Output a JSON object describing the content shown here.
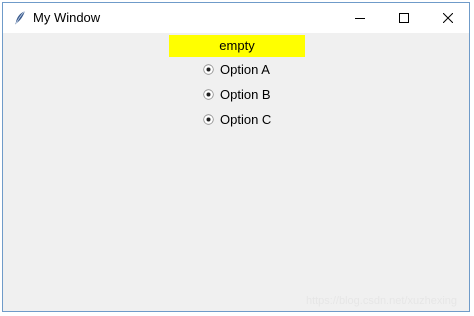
{
  "window": {
    "title": "My Window",
    "app_icon": "feather-icon"
  },
  "controls": {
    "minimize_icon": "minimize-icon",
    "maximize_icon": "maximize-icon",
    "close_icon": "close-icon"
  },
  "label": {
    "text": "empty",
    "background": "#ffff00"
  },
  "radios": [
    {
      "label": "Option A"
    },
    {
      "label": "Option B"
    },
    {
      "label": "Option C"
    }
  ],
  "watermark": "https://blog.csdn.net/xuzhexing"
}
